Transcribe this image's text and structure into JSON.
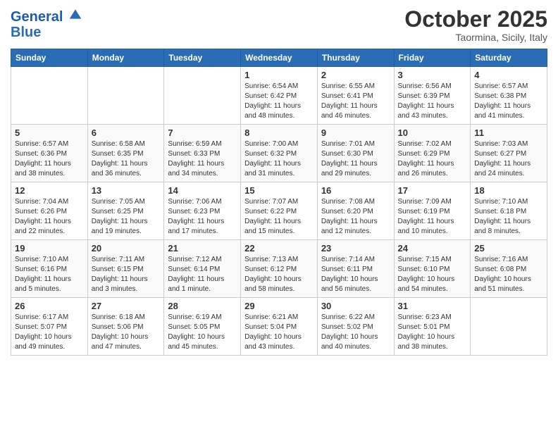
{
  "header": {
    "logo_line1": "General",
    "logo_line2": "Blue",
    "month_title": "October 2025",
    "location": "Taormina, Sicily, Italy"
  },
  "weekdays": [
    "Sunday",
    "Monday",
    "Tuesday",
    "Wednesday",
    "Thursday",
    "Friday",
    "Saturday"
  ],
  "weeks": [
    [
      {
        "day": "",
        "info": ""
      },
      {
        "day": "",
        "info": ""
      },
      {
        "day": "",
        "info": ""
      },
      {
        "day": "1",
        "info": "Sunrise: 6:54 AM\nSunset: 6:42 PM\nDaylight: 11 hours\nand 48 minutes."
      },
      {
        "day": "2",
        "info": "Sunrise: 6:55 AM\nSunset: 6:41 PM\nDaylight: 11 hours\nand 46 minutes."
      },
      {
        "day": "3",
        "info": "Sunrise: 6:56 AM\nSunset: 6:39 PM\nDaylight: 11 hours\nand 43 minutes."
      },
      {
        "day": "4",
        "info": "Sunrise: 6:57 AM\nSunset: 6:38 PM\nDaylight: 11 hours\nand 41 minutes."
      }
    ],
    [
      {
        "day": "5",
        "info": "Sunrise: 6:57 AM\nSunset: 6:36 PM\nDaylight: 11 hours\nand 38 minutes."
      },
      {
        "day": "6",
        "info": "Sunrise: 6:58 AM\nSunset: 6:35 PM\nDaylight: 11 hours\nand 36 minutes."
      },
      {
        "day": "7",
        "info": "Sunrise: 6:59 AM\nSunset: 6:33 PM\nDaylight: 11 hours\nand 34 minutes."
      },
      {
        "day": "8",
        "info": "Sunrise: 7:00 AM\nSunset: 6:32 PM\nDaylight: 11 hours\nand 31 minutes."
      },
      {
        "day": "9",
        "info": "Sunrise: 7:01 AM\nSunset: 6:30 PM\nDaylight: 11 hours\nand 29 minutes."
      },
      {
        "day": "10",
        "info": "Sunrise: 7:02 AM\nSunset: 6:29 PM\nDaylight: 11 hours\nand 26 minutes."
      },
      {
        "day": "11",
        "info": "Sunrise: 7:03 AM\nSunset: 6:27 PM\nDaylight: 11 hours\nand 24 minutes."
      }
    ],
    [
      {
        "day": "12",
        "info": "Sunrise: 7:04 AM\nSunset: 6:26 PM\nDaylight: 11 hours\nand 22 minutes."
      },
      {
        "day": "13",
        "info": "Sunrise: 7:05 AM\nSunset: 6:25 PM\nDaylight: 11 hours\nand 19 minutes."
      },
      {
        "day": "14",
        "info": "Sunrise: 7:06 AM\nSunset: 6:23 PM\nDaylight: 11 hours\nand 17 minutes."
      },
      {
        "day": "15",
        "info": "Sunrise: 7:07 AM\nSunset: 6:22 PM\nDaylight: 11 hours\nand 15 minutes."
      },
      {
        "day": "16",
        "info": "Sunrise: 7:08 AM\nSunset: 6:20 PM\nDaylight: 11 hours\nand 12 minutes."
      },
      {
        "day": "17",
        "info": "Sunrise: 7:09 AM\nSunset: 6:19 PM\nDaylight: 11 hours\nand 10 minutes."
      },
      {
        "day": "18",
        "info": "Sunrise: 7:10 AM\nSunset: 6:18 PM\nDaylight: 11 hours\nand 8 minutes."
      }
    ],
    [
      {
        "day": "19",
        "info": "Sunrise: 7:10 AM\nSunset: 6:16 PM\nDaylight: 11 hours\nand 5 minutes."
      },
      {
        "day": "20",
        "info": "Sunrise: 7:11 AM\nSunset: 6:15 PM\nDaylight: 11 hours\nand 3 minutes."
      },
      {
        "day": "21",
        "info": "Sunrise: 7:12 AM\nSunset: 6:14 PM\nDaylight: 11 hours\nand 1 minute."
      },
      {
        "day": "22",
        "info": "Sunrise: 7:13 AM\nSunset: 6:12 PM\nDaylight: 10 hours\nand 58 minutes."
      },
      {
        "day": "23",
        "info": "Sunrise: 7:14 AM\nSunset: 6:11 PM\nDaylight: 10 hours\nand 56 minutes."
      },
      {
        "day": "24",
        "info": "Sunrise: 7:15 AM\nSunset: 6:10 PM\nDaylight: 10 hours\nand 54 minutes."
      },
      {
        "day": "25",
        "info": "Sunrise: 7:16 AM\nSunset: 6:08 PM\nDaylight: 10 hours\nand 51 minutes."
      }
    ],
    [
      {
        "day": "26",
        "info": "Sunrise: 6:17 AM\nSunset: 5:07 PM\nDaylight: 10 hours\nand 49 minutes."
      },
      {
        "day": "27",
        "info": "Sunrise: 6:18 AM\nSunset: 5:06 PM\nDaylight: 10 hours\nand 47 minutes."
      },
      {
        "day": "28",
        "info": "Sunrise: 6:19 AM\nSunset: 5:05 PM\nDaylight: 10 hours\nand 45 minutes."
      },
      {
        "day": "29",
        "info": "Sunrise: 6:21 AM\nSunset: 5:04 PM\nDaylight: 10 hours\nand 43 minutes."
      },
      {
        "day": "30",
        "info": "Sunrise: 6:22 AM\nSunset: 5:02 PM\nDaylight: 10 hours\nand 40 minutes."
      },
      {
        "day": "31",
        "info": "Sunrise: 6:23 AM\nSunset: 5:01 PM\nDaylight: 10 hours\nand 38 minutes."
      },
      {
        "day": "",
        "info": ""
      }
    ]
  ]
}
